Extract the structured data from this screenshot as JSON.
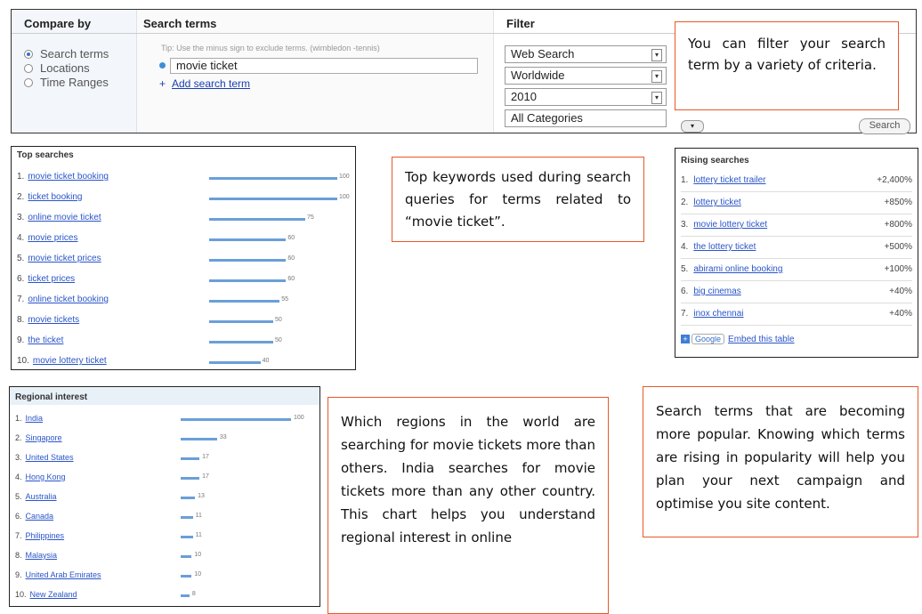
{
  "compare": {
    "compare_by_heading": "Compare by",
    "search_terms_heading": "Search terms",
    "filter_heading": "Filter",
    "options": [
      {
        "label": "Search terms",
        "selected": true
      },
      {
        "label": "Locations",
        "selected": false
      },
      {
        "label": "Time Ranges",
        "selected": false
      }
    ],
    "tip": "Tip: Use the minus sign to exclude terms. (wimbledon -tennis)",
    "term_value": "movie ticket",
    "add_term": "Add search term",
    "add_plus": "+",
    "filters": [
      "Web Search",
      "Worldwide",
      "2010",
      "All Categories"
    ],
    "search_button": "Search"
  },
  "notes": {
    "filter": "You can filter your search term by a variety of criteria.",
    "top": "Top keywords used during search queries for terms related to “movie ticket”.",
    "regional": "Which regions in the world are searching for movie tickets more than others. India searches for movie tickets more than any other country. This chart helps you understand regional interest in online",
    "rising": "Search terms that are becoming more popular. Knowing which terms are rising in popularity will help you plan your next campaign and optimise you site content."
  },
  "top_searches": {
    "title": "Top searches",
    "rows": [
      {
        "num": "1.",
        "term": "movie ticket booking",
        "value": 100
      },
      {
        "num": "2.",
        "term": "ticket booking",
        "value": 100
      },
      {
        "num": "3.",
        "term": "online movie ticket",
        "value": 75
      },
      {
        "num": "4.",
        "term": "movie prices",
        "value": 60
      },
      {
        "num": "5.",
        "term": "movie ticket prices",
        "value": 60
      },
      {
        "num": "6.",
        "term": "ticket prices",
        "value": 60
      },
      {
        "num": "7.",
        "term": "online ticket booking",
        "value": 55
      },
      {
        "num": "8.",
        "term": "movie tickets",
        "value": 50
      },
      {
        "num": "9.",
        "term": "the ticket",
        "value": 50
      },
      {
        "num": "10.",
        "term": "movie lottery ticket",
        "value": 40
      }
    ]
  },
  "rising_searches": {
    "title": "Rising searches",
    "rows": [
      {
        "num": "1.",
        "term": "lottery ticket trailer",
        "change": "+2,400%"
      },
      {
        "num": "2.",
        "term": "lottery ticket",
        "change": "+850%"
      },
      {
        "num": "3.",
        "term": "movie lottery ticket",
        "change": "+800%"
      },
      {
        "num": "4.",
        "term": "the lottery ticket",
        "change": "+500%"
      },
      {
        "num": "5.",
        "term": "abirami online booking",
        "change": "+100%"
      },
      {
        "num": "6.",
        "term": "big cinemas",
        "change": "+40%"
      },
      {
        "num": "7.",
        "term": "inox chennai",
        "change": "+40%"
      }
    ],
    "google_label": "Google",
    "embed_label": "Embed this table"
  },
  "regional_interest": {
    "title": "Regional interest",
    "rows": [
      {
        "num": "1.",
        "region": "India",
        "value": 100
      },
      {
        "num": "2.",
        "region": "Singapore",
        "value": 33
      },
      {
        "num": "3.",
        "region": "United States",
        "value": 17
      },
      {
        "num": "4.",
        "region": "Hong Kong",
        "value": 17
      },
      {
        "num": "5.",
        "region": "Australia",
        "value": 13
      },
      {
        "num": "6.",
        "region": "Canada",
        "value": 11
      },
      {
        "num": "7.",
        "region": "Philippines",
        "value": 11
      },
      {
        "num": "8.",
        "region": "Malaysia",
        "value": 10
      },
      {
        "num": "9.",
        "region": "United Arab Emirates",
        "value": 10
      },
      {
        "num": "10.",
        "region": "New Zealand",
        "value": 8
      }
    ]
  }
}
